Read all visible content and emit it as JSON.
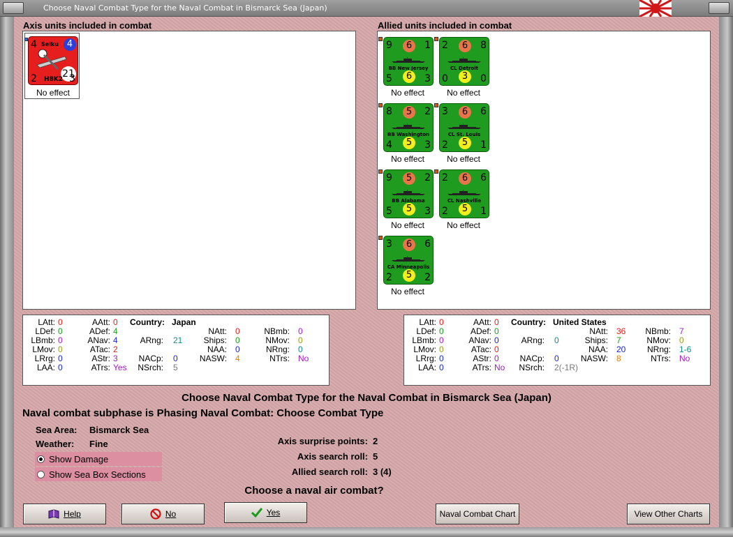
{
  "window": {
    "title": "Choose Naval Combat Type for the Naval Combat in Bismarck Sea (Japan)"
  },
  "axis_panel": {
    "header": "Axis units included in combat",
    "units": [
      {
        "type": "air",
        "name": "Seiku",
        "model": "H8K2",
        "tl": "4",
        "tr": "4",
        "bl": "2",
        "br": "3",
        "center": "21",
        "effect": "No effect"
      }
    ]
  },
  "allied_panel": {
    "header": "Allied units included in combat",
    "units": [
      {
        "name": "BB New Jersey",
        "tl": "9",
        "top": "6",
        "tr": "1",
        "bl": "5",
        "bottom": "6",
        "br": "3",
        "effect": "No effect"
      },
      {
        "name": "CL Detroit",
        "tl": "2",
        "top": "6",
        "tr": "8",
        "bl": "0",
        "bottom": "3",
        "br": "0",
        "effect": "No effect"
      },
      {
        "name": "BB Washington",
        "tl": "8",
        "top": "5",
        "tr": "2",
        "bl": "4",
        "bottom": "5",
        "br": "3",
        "effect": "No effect"
      },
      {
        "name": "CL St. Louis",
        "tl": "3",
        "top": "6",
        "tr": "6",
        "bl": "2",
        "bottom": "5",
        "br": "1",
        "effect": "No effect"
      },
      {
        "name": "BB Alabama",
        "tl": "9",
        "top": "5",
        "tr": "2",
        "bl": "5",
        "bottom": "5",
        "br": "3",
        "effect": "No effect"
      },
      {
        "name": "CL Nashville",
        "tl": "2",
        "top": "6",
        "tr": "6",
        "bl": "2",
        "bottom": "5",
        "br": "1",
        "effect": "No effect"
      },
      {
        "name": "CA Minneapolis",
        "tl": "3",
        "top": "6",
        "tr": "6",
        "bl": "2",
        "bottom": "5",
        "br": "2",
        "effect": "No effect"
      }
    ]
  },
  "axis_stats": {
    "country_label": "Country:",
    "country": "Japan",
    "LAtt": "0",
    "LDef": "0",
    "LBmb": "0",
    "LMov": "0",
    "LRrg": "0",
    "LAA": "0",
    "AAtt": "0",
    "ADef": "4",
    "ANav": "4",
    "ATac": "2",
    "AStr": "3",
    "ATrs": "Yes",
    "ARng": "21",
    "NACp": "0",
    "NSrch": "5",
    "NAtt": "0",
    "Ships": "0",
    "NAA": "0",
    "NASW": "4",
    "NBmb": "0",
    "NMov": "0",
    "NRng": "0",
    "NTrs": "No"
  },
  "allied_stats": {
    "country_label": "Country:",
    "country": "United States",
    "LAtt": "0",
    "LDef": "0",
    "LBmb": "0",
    "LMov": "0",
    "LRrg": "0",
    "LAA": "0",
    "AAtt": "0",
    "ADef": "0",
    "ANav": "0",
    "ATac": "0",
    "AStr": "0",
    "ATrs": "No",
    "ARng": "0",
    "NACp": "0",
    "NSrch": "2(-1R)",
    "NAtt": "36",
    "Ships": "7",
    "NAA": "20",
    "NASW": "8",
    "NBmb": "7",
    "NMov": "0",
    "NRng": "1-6",
    "NTrs": "No"
  },
  "info": {
    "heading": "Choose Naval Combat Type for the Naval Combat in Bismarck Sea (Japan)",
    "subphase": "Naval combat subphase is Phasing Naval Combat: Choose Combat Type",
    "sea_area_label": "Sea Area:",
    "sea_area": "Bismarck Sea",
    "weather_label": "Weather:",
    "weather": "Fine",
    "show_damage": "Show Damage",
    "show_sea_box": "Show Sea Box Sections",
    "axis_surprise_label": "Axis surprise points:",
    "axis_surprise": "2",
    "axis_search_label": "Axis search roll:",
    "axis_search": "5",
    "allied_search_label": "Allied search roll:",
    "allied_search": "3 (4)",
    "question": "Choose a naval air combat?"
  },
  "buttons": {
    "help": "Help",
    "no": "No",
    "yes": "Yes",
    "naval_chart": "Naval Combat Chart",
    "other_charts": "View Other Charts"
  }
}
